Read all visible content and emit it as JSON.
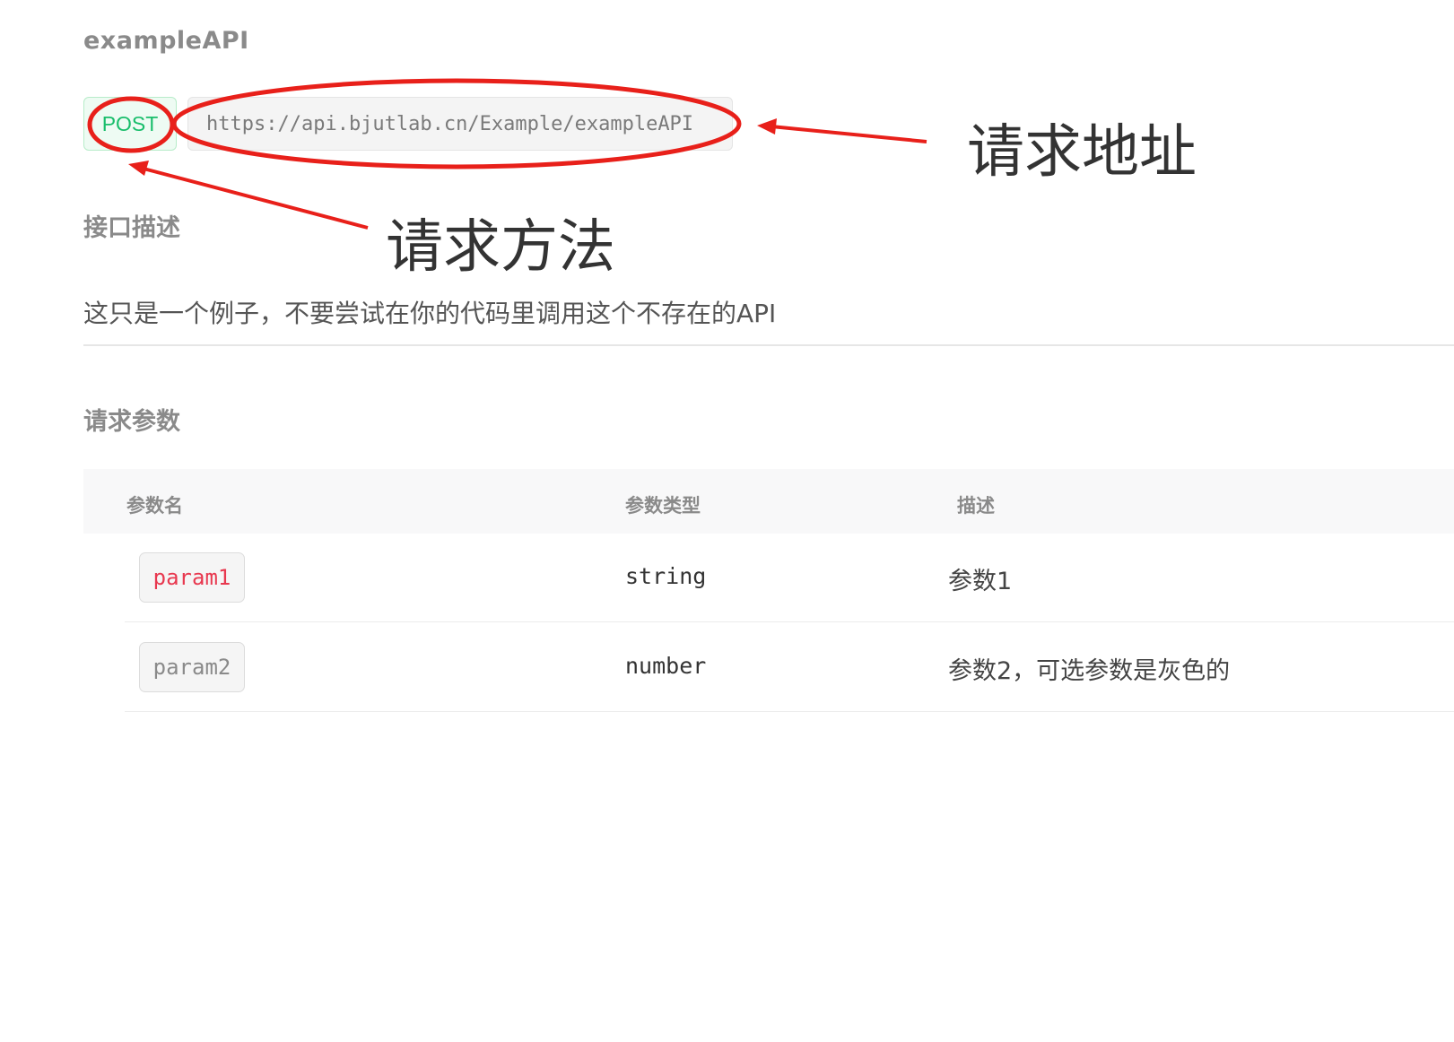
{
  "api": {
    "name": "exampleAPI",
    "method": "POST",
    "url": "https://api.bjutlab.cn/Example/exampleAPI"
  },
  "description": {
    "heading": "接口描述",
    "text": "这只是一个例子，不要尝试在你的代码里调用这个不存在的API"
  },
  "params": {
    "heading": "请求参数",
    "columns": [
      "参数名",
      "参数类型",
      "描述"
    ],
    "rows": [
      {
        "name": "param1",
        "type": "string",
        "desc": "参数1",
        "required": true
      },
      {
        "name": "param2",
        "type": "number",
        "desc": "参数2，可选参数是灰色的",
        "required": false
      }
    ]
  },
  "annotations": {
    "url_label": "请求地址",
    "method_label": "请求方法",
    "color": "#e8201a"
  },
  "colors": {
    "method_green": "#19be6b",
    "required_red": "#e8384f",
    "muted_gray": "#8a8a8a"
  }
}
